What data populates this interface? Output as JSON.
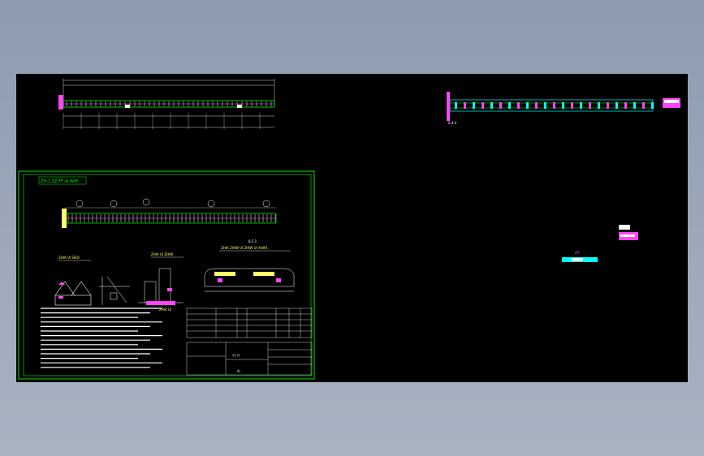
{
  "drawing": {
    "background": "#000000",
    "frame_color": "#00ff00",
    "accent_magenta": "#ff44ff",
    "accent_cyan": "#00ffff",
    "accent_yellow": "#ffff66",
    "sheet_heading": "ZH-1 SZ-FF IA WIIF",
    "tag_left": "0.4.4",
    "section_label": "8.2.1",
    "stamp": "?? ??"
  },
  "views": {
    "top_left": "top-left-elevation",
    "top_right": "top-right-strip",
    "sheet": "bottom-left-sheet",
    "legend_small": "right-small-legend"
  }
}
